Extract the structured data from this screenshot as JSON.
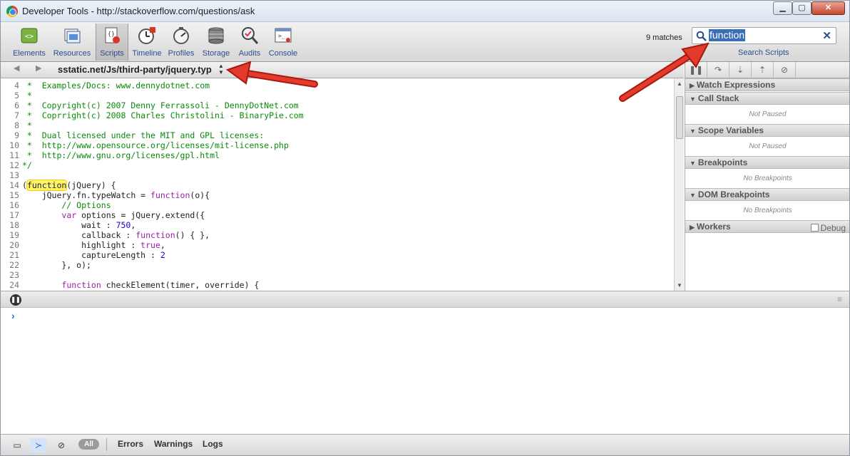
{
  "window": {
    "title": "Developer Tools - http://stackoverflow.com/questions/ask",
    "minimize": "▁",
    "maximize": "▢",
    "close": "✕"
  },
  "toolbar": {
    "tools": [
      {
        "label": "Elements",
        "icon": "elements-icon"
      },
      {
        "label": "Resources",
        "icon": "resources-icon"
      },
      {
        "label": "Scripts",
        "icon": "scripts-icon",
        "selected": true
      },
      {
        "label": "Timeline",
        "icon": "timeline-icon"
      },
      {
        "label": "Profiles",
        "icon": "profiles-icon"
      },
      {
        "label": "Storage",
        "icon": "storage-icon"
      },
      {
        "label": "Audits",
        "icon": "audits-icon"
      },
      {
        "label": "Console",
        "icon": "console-icon"
      }
    ],
    "matches": "9 matches",
    "search_value": "function",
    "search_label": "Search Scripts"
  },
  "scripts": {
    "path": "sstatic.net/Js/third-party/jquery.typ",
    "back": "◀",
    "forward": "▶",
    "updown": "▲▼"
  },
  "debugger_buttons": [
    {
      "glyph": "❚❚",
      "icon": "pause-icon"
    },
    {
      "glyph": "↷",
      "icon": "step-over-icon"
    },
    {
      "glyph": "⇣",
      "icon": "step-into-icon"
    },
    {
      "glyph": "⇡",
      "icon": "step-out-icon"
    },
    {
      "glyph": "⊘",
      "icon": "deactivate-breakpoints-icon"
    }
  ],
  "code_lines": [
    {
      "n": "4",
      "parts": [
        {
          "t": " *  Examples/Docs: www.dennydotnet.com",
          "c": "c-comment"
        }
      ]
    },
    {
      "n": "5",
      "parts": [
        {
          "t": " *",
          "c": "c-comment"
        }
      ]
    },
    {
      "n": "6",
      "parts": [
        {
          "t": " *  Copyright(c) 2007 Denny Ferrassoli - DennyDotNet.com",
          "c": "c-comment"
        }
      ]
    },
    {
      "n": "7",
      "parts": [
        {
          "t": " *  Coprright(c) 2008 Charles Christolini - BinaryPie.com",
          "c": "c-comment"
        }
      ]
    },
    {
      "n": "8",
      "parts": [
        {
          "t": " *",
          "c": "c-comment"
        }
      ]
    },
    {
      "n": "9",
      "parts": [
        {
          "t": " *  Dual licensed under the MIT and GPL licenses:",
          "c": "c-comment"
        }
      ]
    },
    {
      "n": "10",
      "parts": [
        {
          "t": " *  http://www.opensource.org/licenses/mit-license.php",
          "c": "c-comment"
        }
      ]
    },
    {
      "n": "11",
      "parts": [
        {
          "t": " *  http://www.gnu.org/licenses/gpl.html",
          "c": "c-comment"
        }
      ]
    },
    {
      "n": "12",
      "parts": [
        {
          "t": "*/",
          "c": "c-comment"
        }
      ]
    },
    {
      "n": "13",
      "parts": [
        {
          "t": "",
          "c": "c-plain"
        }
      ]
    },
    {
      "n": "14",
      "parts": [
        {
          "t": "(",
          "c": "c-plain"
        },
        {
          "t": "function",
          "c": "c-plain hl"
        },
        {
          "t": "(jQuery) {",
          "c": "c-plain"
        }
      ]
    },
    {
      "n": "15",
      "parts": [
        {
          "t": "    jQuery.fn.typeWatch = ",
          "c": "c-plain"
        },
        {
          "t": "function",
          "c": "c-kw"
        },
        {
          "t": "(o){",
          "c": "c-plain"
        }
      ]
    },
    {
      "n": "16",
      "parts": [
        {
          "t": "        // Options",
          "c": "c-comment"
        }
      ]
    },
    {
      "n": "17",
      "parts": [
        {
          "t": "        ",
          "c": "c-plain"
        },
        {
          "t": "var",
          "c": "c-kw"
        },
        {
          "t": " options = jQuery.extend({",
          "c": "c-plain"
        }
      ]
    },
    {
      "n": "18",
      "parts": [
        {
          "t": "            wait : ",
          "c": "c-plain"
        },
        {
          "t": "750",
          "c": "c-num"
        },
        {
          "t": ",",
          "c": "c-plain"
        }
      ]
    },
    {
      "n": "19",
      "parts": [
        {
          "t": "            callback : ",
          "c": "c-plain"
        },
        {
          "t": "function",
          "c": "c-kw"
        },
        {
          "t": "() { },",
          "c": "c-plain"
        }
      ]
    },
    {
      "n": "20",
      "parts": [
        {
          "t": "            highlight : ",
          "c": "c-plain"
        },
        {
          "t": "true",
          "c": "c-kw"
        },
        {
          "t": ",",
          "c": "c-plain"
        }
      ]
    },
    {
      "n": "21",
      "parts": [
        {
          "t": "            captureLength : ",
          "c": "c-plain"
        },
        {
          "t": "2",
          "c": "c-num"
        }
      ]
    },
    {
      "n": "22",
      "parts": [
        {
          "t": "        }, o);",
          "c": "c-plain"
        }
      ]
    },
    {
      "n": "23",
      "parts": [
        {
          "t": "",
          "c": "c-plain"
        }
      ]
    },
    {
      "n": "24",
      "parts": [
        {
          "t": "        ",
          "c": "c-plain"
        },
        {
          "t": "function",
          "c": "c-kw"
        },
        {
          "t": " checkElement(timer, override) {",
          "c": "c-plain"
        }
      ]
    }
  ],
  "sidebar": {
    "sections": [
      {
        "title": "Watch Expressions",
        "body": ""
      },
      {
        "title": "Call Stack",
        "body": "Not Paused"
      },
      {
        "title": "Scope Variables",
        "body": "Not Paused"
      },
      {
        "title": "Breakpoints",
        "body": "No Breakpoints"
      },
      {
        "title": "DOM Breakpoints",
        "body": "No Breakpoints"
      },
      {
        "title": "Workers",
        "body": ""
      }
    ],
    "debug_label": "Debug"
  },
  "console": {
    "prompt": "›"
  },
  "statusbar": {
    "all_label": "All",
    "errors": "Errors",
    "warnings": "Warnings",
    "logs": "Logs"
  }
}
